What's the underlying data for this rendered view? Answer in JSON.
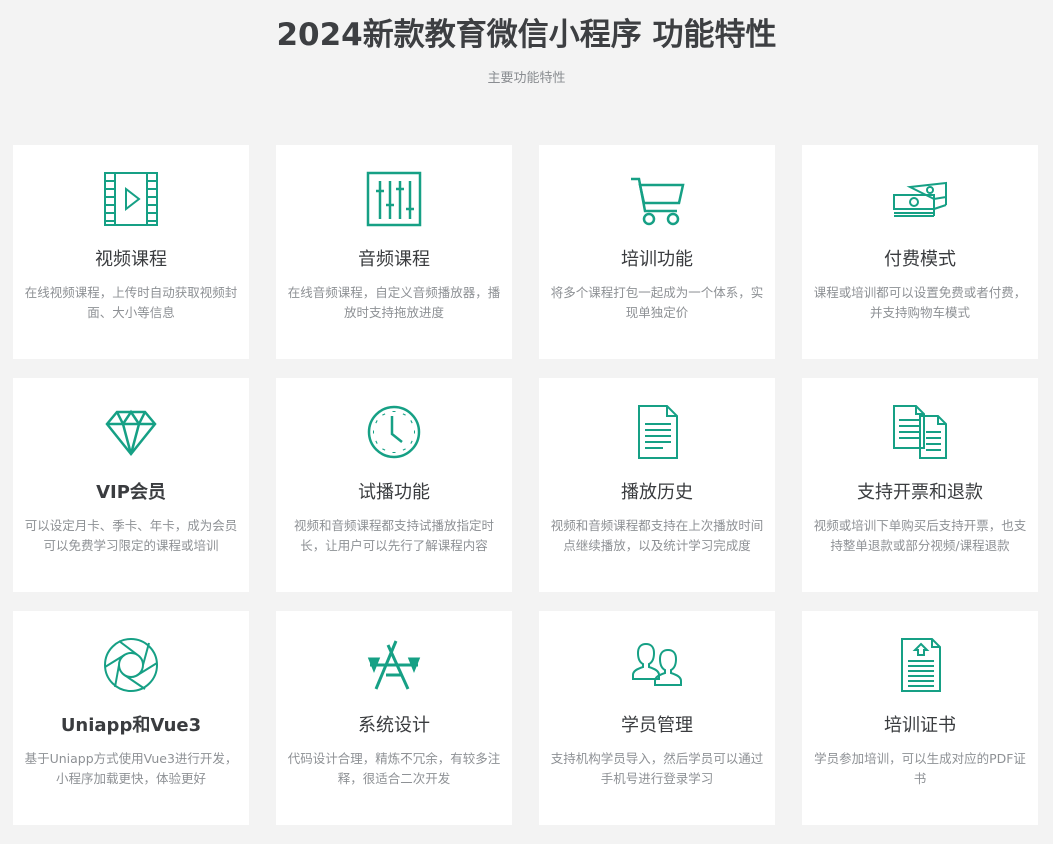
{
  "header": {
    "title": "2024新款教育微信小程序 功能特性",
    "subtitle": "主要功能特性"
  },
  "colors": {
    "accent": "#16a085",
    "background": "#f3f3f3",
    "card": "#ffffff",
    "title_text": "#3d3f42",
    "desc_text": "#8e9195"
  },
  "features": [
    {
      "title": "视频课程",
      "desc": "在线视频课程，上传时自动获取视频封面、大小等信息",
      "icon": "video-film-icon"
    },
    {
      "title": "音频课程",
      "desc": "在线音频课程，自定义音频播放器，播放时支持拖放进度",
      "icon": "audio-mixer-icon"
    },
    {
      "title": "培训功能",
      "desc": "将多个课程打包一起成为一个体系，实现单独定价",
      "icon": "shopping-cart-icon"
    },
    {
      "title": "付费模式",
      "desc": "课程或培训都可以设置免费或者付费，并支持购物车模式",
      "icon": "money-stack-icon"
    },
    {
      "title": "VIP会员",
      "desc": "可以设定月卡、季卡、年卡，成为会员可以免费学习限定的课程或培训",
      "icon": "diamond-icon"
    },
    {
      "title": "试播功能",
      "desc": "视频和音频课程都支持试播放指定时长，让用户可以先行了解课程内容",
      "icon": "clock-icon"
    },
    {
      "title": "播放历史",
      "desc": "视频和音频课程都支持在上次播放时间点继续播放，以及统计学习完成度",
      "icon": "document-icon"
    },
    {
      "title": "支持开票和退款",
      "desc": "视频或培训下单购买后支持开票，也支持整单退款或部分视频/课程退款",
      "icon": "documents-icon"
    },
    {
      "title": "Uniapp和Vue3",
      "desc": "基于Uniapp方式使用Vue3进行开发，小程序加载更快，体验更好",
      "icon": "aperture-icon"
    },
    {
      "title": "系统设计",
      "desc": "代码设计合理，精炼不冗余，有较多注释，很适合二次开发",
      "icon": "app-store-icon"
    },
    {
      "title": "学员管理",
      "desc": "支持机构学员导入，然后学员可以通过手机号进行登录学习",
      "icon": "users-icon"
    },
    {
      "title": "培训证书",
      "desc": "学员参加培训，可以生成对应的PDF证书",
      "icon": "certificate-icon"
    }
  ]
}
